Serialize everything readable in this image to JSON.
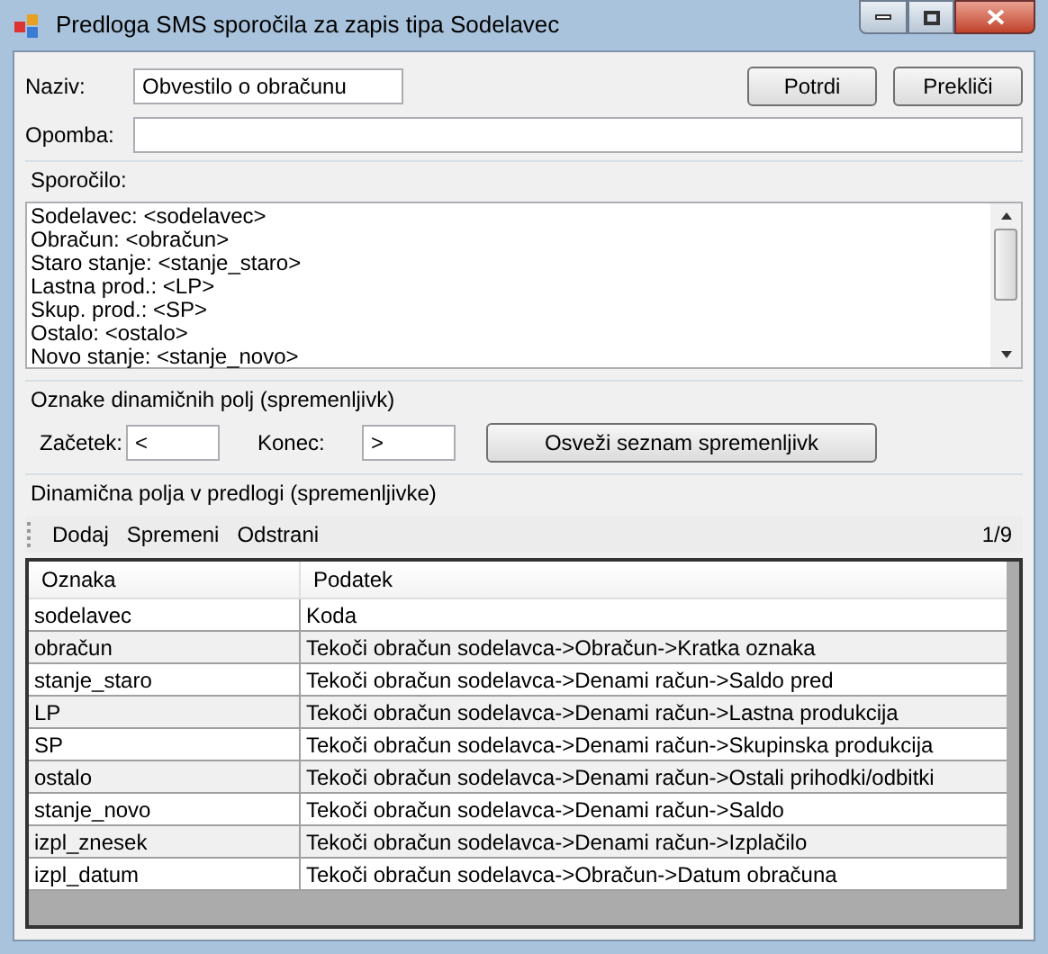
{
  "window": {
    "title": "Predloga SMS sporočila za zapis tipa Sodelavec"
  },
  "form": {
    "name_label": "Naziv:",
    "name_value": "Obvestilo o obračunu",
    "note_label": "Opomba:",
    "buttons": [
      "Potrdi",
      "Prekliči"
    ]
  },
  "message": {
    "label": "Sporočilo:",
    "lines": [
      "Sodelavec: <sodelavec>",
      "Obračun: <obračun>",
      "Staro stanje: <stanje_staro>",
      "Lastna prod.: <LP>",
      "Skup. prod.: <SP>",
      "Ostalo: <ostalo>",
      "Novo stanje: <stanje_novo>"
    ]
  },
  "markers": {
    "title": "Oznake dinamičnih polj (spremenljivk)",
    "start_label": "Začetek:",
    "start_value": "<",
    "end_label": "Konec:",
    "end_value": ">",
    "refresh_button": "Osveži seznam spremenljivk"
  },
  "fields": {
    "title": "Dinamična polja v predlogi (spremenljivke)",
    "toolbar": [
      "Dodaj",
      "Spremeni",
      "Odstrani"
    ],
    "position": "1/9",
    "columns": [
      "Oznaka",
      "Podatek"
    ],
    "rows": [
      [
        "sodelavec",
        "Koda"
      ],
      [
        "obračun",
        "Tekoči obračun sodelavca->Obračun->Kratka oznaka"
      ],
      [
        "stanje_staro",
        "Tekoči obračun sodelavca->Denami račun->Saldo pred"
      ],
      [
        "LP",
        "Tekoči obračun sodelavca->Denami račun->Lastna produkcija"
      ],
      [
        "SP",
        "Tekoči obračun sodelavca->Denami račun->Skupinska produkcija"
      ],
      [
        "ostalo",
        "Tekoči obračun sodelavca->Denami račun->Ostali prihodki/odbitki"
      ],
      [
        "stanje_novo",
        "Tekoči obračun sodelavca->Denami račun->Saldo"
      ],
      [
        "izpl_znesek",
        "Tekoči obračun sodelavca->Denami račun->Izplačilo"
      ],
      [
        "izpl_datum",
        "Tekoči obračun sodelavca->Obračun->Datum obračuna"
      ]
    ]
  }
}
